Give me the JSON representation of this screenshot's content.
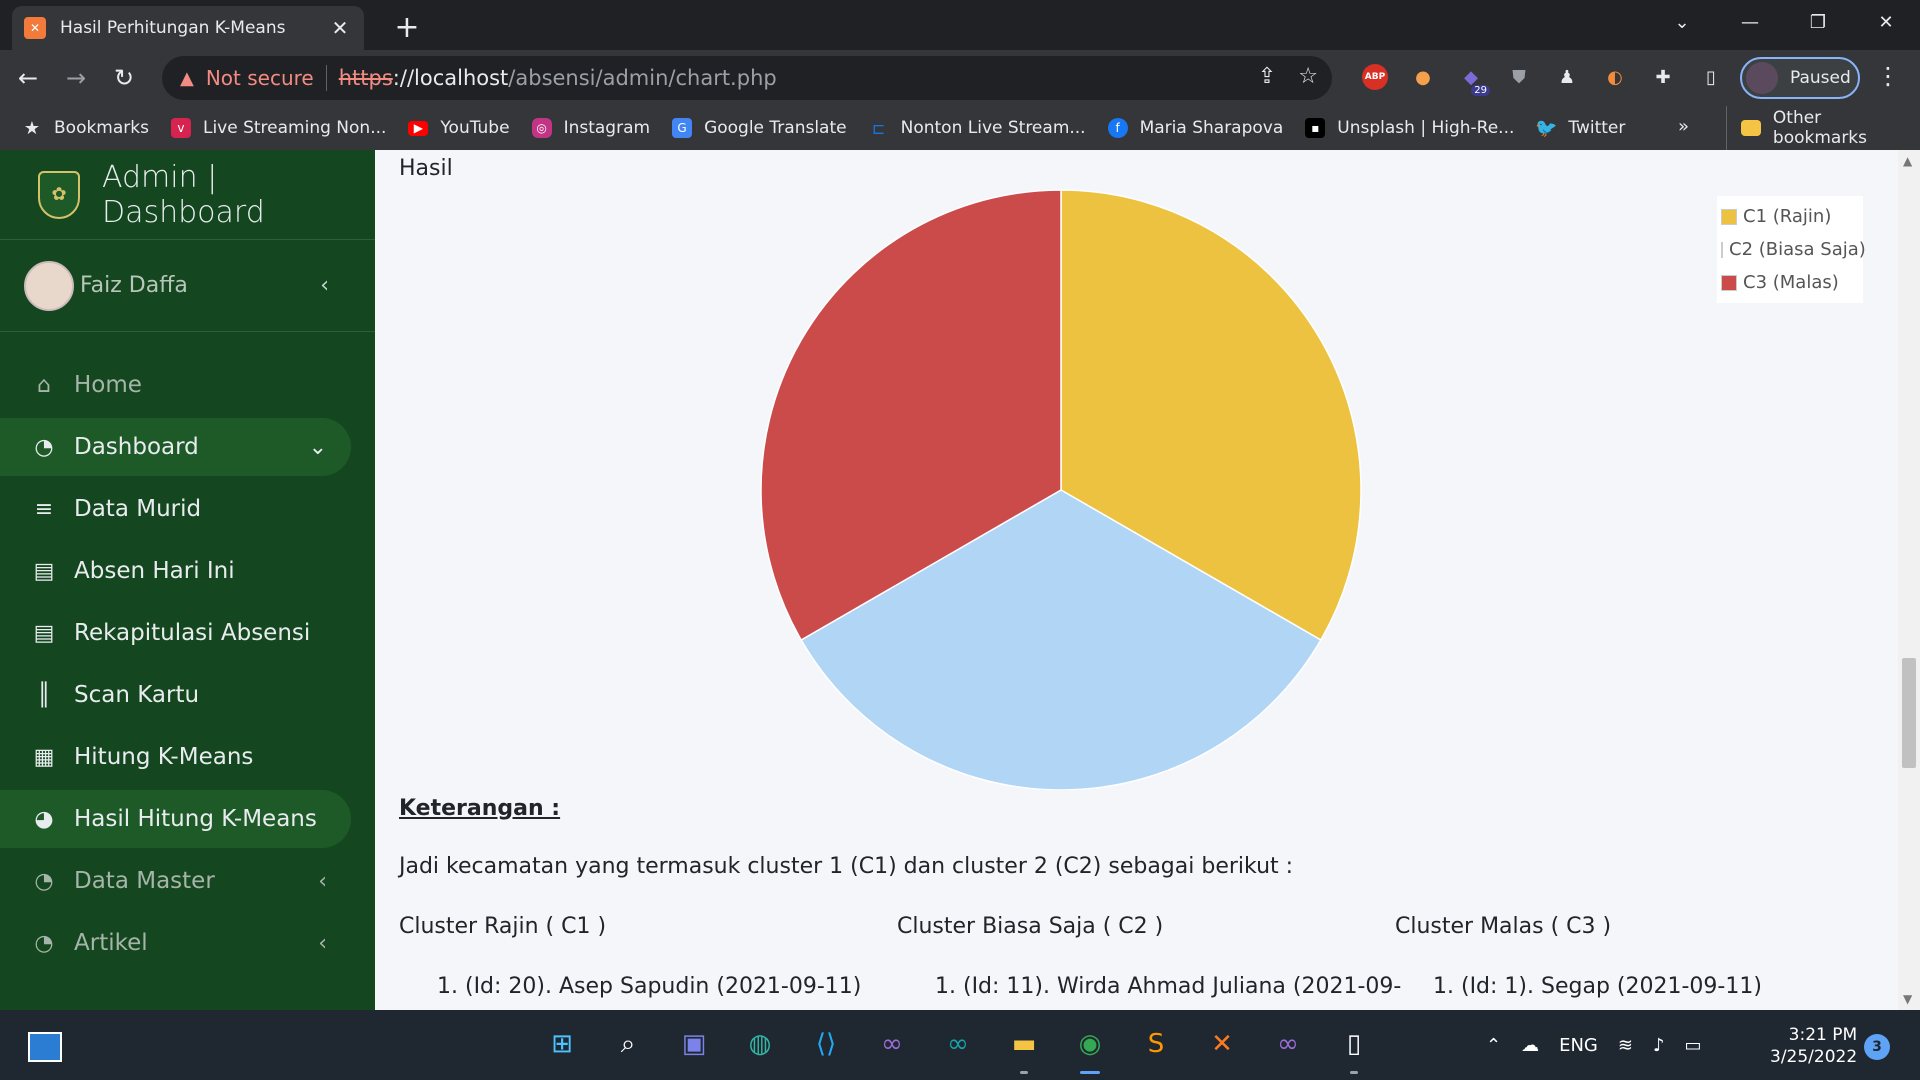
{
  "browser": {
    "tab_title": "Hasil Perhitungan K-Means",
    "tab_close": "✕",
    "new_tab": "+",
    "url_warning": "Not secure",
    "url_protocol": "https",
    "url_host": "://localhost",
    "url_path": "/absensi/admin/chart.php",
    "profile_label": "Paused",
    "extension_badge": "29",
    "abp_label": "ABP"
  },
  "bookmarks": {
    "items": [
      {
        "label": "Bookmarks",
        "icon": "star-icon",
        "color": "#e8eaed"
      },
      {
        "label": "Live Streaming Non...",
        "icon": "vidio-icon",
        "color": "#d6234f"
      },
      {
        "label": "YouTube",
        "icon": "youtube-icon",
        "color": "#ff0000"
      },
      {
        "label": "Instagram",
        "icon": "instagram-icon",
        "color": "#c13584"
      },
      {
        "label": "Google Translate",
        "icon": "translate-icon",
        "color": "#4285f4"
      },
      {
        "label": "Nonton Live Stream...",
        "icon": "rcti-icon",
        "color": "#1a73e8"
      },
      {
        "label": "Maria Sharapova",
        "icon": "facebook-icon",
        "color": "#1877f2"
      },
      {
        "label": "Unsplash | High-Re...",
        "icon": "unsplash-icon",
        "color": "#000000"
      },
      {
        "label": "Twitter",
        "icon": "twitter-icon",
        "color": "#1da1f2"
      }
    ],
    "overflow": "»",
    "other": "Other bookmarks"
  },
  "sidebar": {
    "brand": "Admin | Dashboard",
    "user_name": "Faiz Daffa",
    "items": [
      {
        "label": "Home",
        "icon": "home-icon"
      },
      {
        "label": "Dashboard",
        "icon": "dashboard-icon"
      },
      {
        "label": "Data Murid",
        "icon": "database-icon"
      },
      {
        "label": "Absen Hari Ini",
        "icon": "book-icon"
      },
      {
        "label": "Rekapitulasi Absensi",
        "icon": "book-icon"
      },
      {
        "label": "Scan Kartu",
        "icon": "barcode-icon"
      },
      {
        "label": "Hitung K-Means",
        "icon": "calculator-icon"
      },
      {
        "label": "Hasil Hitung K-Means",
        "icon": "pie-chart-icon"
      },
      {
        "label": "Data Master",
        "icon": "dashboard-icon"
      },
      {
        "label": "Artikel",
        "icon": "dashboard-icon"
      }
    ]
  },
  "content": {
    "section_label": "Hasil",
    "keterangan": "Keterangan :",
    "description": "Jadi kecamatan yang termasuk cluster 1 (C1) dan cluster 2 (C2) sebagai berikut :",
    "clusters": [
      {
        "heading": "Cluster Rajin ( C1 )",
        "first_item": "1. (Id: 20). Asep Sapudin (2021-09-11)"
      },
      {
        "heading": "Cluster Biasa Saja ( C2 )",
        "first_item": "1. (Id: 11). Wirda Ahmad Juliana (2021-09-"
      },
      {
        "heading": "Cluster Malas ( C3 )",
        "first_item": "1. (Id: 1). Segap (2021-09-11)"
      }
    ]
  },
  "chart_data": {
    "type": "pie",
    "title": "",
    "legend_position": "top-right",
    "slices": [
      {
        "label": "C1 (Rajin)",
        "value": 1,
        "color": "#ecc240"
      },
      {
        "label": "C2 (Biasa Saja)",
        "value": 1,
        "color": "#b1d6f5"
      },
      {
        "label": "C3 (Malas)",
        "value": 1,
        "color": "#cb4b4b"
      }
    ]
  },
  "taskbar": {
    "language": "ENG",
    "time": "3:21 PM",
    "date": "3/25/2022",
    "notifications": "3"
  }
}
